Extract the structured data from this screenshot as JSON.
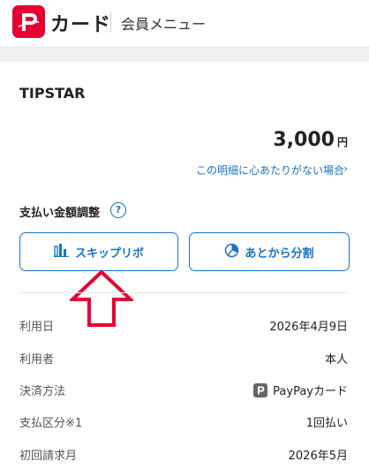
{
  "header": {
    "brand": "カード",
    "title": "会員メニュー"
  },
  "transaction": {
    "merchant": "TIPSTAR",
    "amount": "3,000",
    "currency": "円",
    "detail_link": "この明細に心あたりがない場合",
    "detail_link_chevron": "›"
  },
  "adjust": {
    "label": "支払い金額調整",
    "help": "?",
    "skip_label": "スキップリボ",
    "split_label": "あとから分割"
  },
  "info": [
    {
      "label": "利用日",
      "value": "2026年4月9日"
    },
    {
      "label": "利用者",
      "value": "本人"
    },
    {
      "label": "決済方法",
      "value": "PayPayカード"
    },
    {
      "label": "支払区分※1",
      "value": "1回払い"
    },
    {
      "label": "初回請求月",
      "value": "2026年5月"
    }
  ],
  "colors": {
    "brand": "#e60033",
    "accent": "#1a73c8",
    "arrow": "#e60033"
  }
}
